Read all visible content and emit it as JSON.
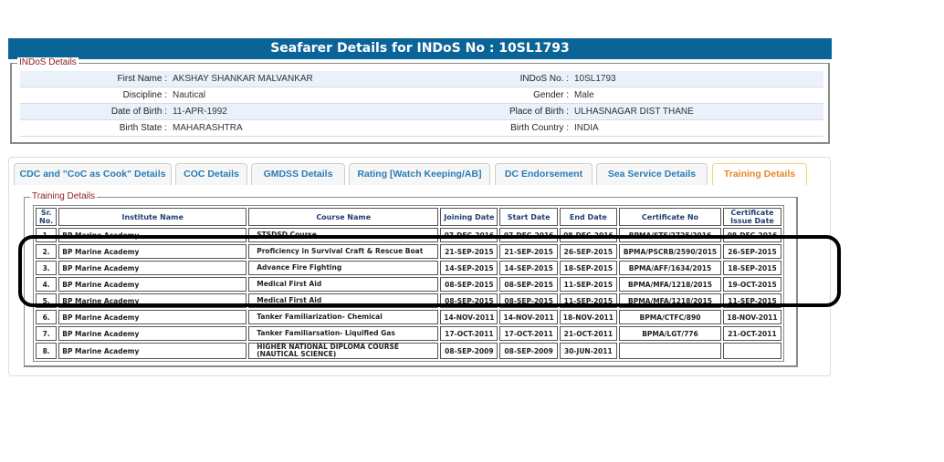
{
  "header": {
    "title": "Seafarer Details for INDoS No : 10SL1793"
  },
  "indos": {
    "legend": "INDoS Details",
    "rows": [
      {
        "l_label": "First Name :",
        "l_value": "AKSHAY SHANKAR MALVANKAR",
        "r_label": "INDoS No. :",
        "r_value": "10SL1793"
      },
      {
        "l_label": "Discipline :",
        "l_value": "Nautical",
        "r_label": "Gender :",
        "r_value": "Male"
      },
      {
        "l_label": "Date of Birth :",
        "l_value": "11-APR-1992",
        "r_label": "Place of Birth :",
        "r_value": "ULHASNAGAR DIST THANE"
      },
      {
        "l_label": "Birth State :",
        "l_value": "MAHARASHTRA",
        "r_label": "Birth Country :",
        "r_value": "INDIA"
      }
    ]
  },
  "tabs": [
    "CDC and \"CoC as Cook\" Details",
    "COC Details",
    "GMDSS Details",
    "Rating [Watch Keeping/AB]",
    "DC Endorsement",
    "Sea Service Details",
    "Training Details"
  ],
  "training": {
    "legend": "Training Details",
    "columns": [
      "Sr. No.",
      "Institute Name",
      "Course Name",
      "Joining Date",
      "Start Date",
      "End Date",
      "Certificate No",
      "Certificate Issue Date"
    ],
    "rows": [
      [
        "1.",
        "BP Marine Academy",
        "STSDSD Course",
        "07-DEC-2016",
        "07-DEC-2016",
        "08-DEC-2016",
        "BPMA/STS/2725/2016",
        "08-DEC-2016"
      ],
      [
        "2.",
        "BP Marine Academy",
        "Proficiency in Survival Craft & Rescue Boat",
        "21-SEP-2015",
        "21-SEP-2015",
        "26-SEP-2015",
        "BPMA/PSCRB/2590/2015",
        "26-SEP-2015"
      ],
      [
        "3.",
        "BP Marine Academy",
        "Advance Fire Fighting",
        "14-SEP-2015",
        "14-SEP-2015",
        "18-SEP-2015",
        "BPMA/AFF/1634/2015",
        "18-SEP-2015"
      ],
      [
        "4.",
        "BP Marine Academy",
        "Medical First Aid",
        "08-SEP-2015",
        "08-SEP-2015",
        "11-SEP-2015",
        "BPMA/MFA/1218/2015",
        "19-OCT-2015"
      ],
      [
        "5.",
        "BP Marine Academy",
        "Medical First Aid",
        "08-SEP-2015",
        "08-SEP-2015",
        "11-SEP-2015",
        "BPMA/MFA/1218/2015",
        "11-SEP-2015"
      ],
      [
        "6.",
        "BP Marine Academy",
        "Tanker Familiarization- Chemical",
        "14-NOV-2011",
        "14-NOV-2011",
        "18-NOV-2011",
        "BPMA/CTFC/890",
        "18-NOV-2011"
      ],
      [
        "7.",
        "BP Marine Academy",
        "Tanker Familiarsation- Liquified Gas",
        "17-OCT-2011",
        "17-OCT-2011",
        "21-OCT-2011",
        "BPMA/LGT/776",
        "21-OCT-2011"
      ],
      [
        "8.",
        "BP Marine Academy",
        "HIGHER NATIONAL DIPLOMA COURSE (NAUTICAL SCIENCE)",
        "08-SEP-2009",
        "08-SEP-2009",
        "30-JUN-2011",
        "",
        ""
      ]
    ]
  }
}
